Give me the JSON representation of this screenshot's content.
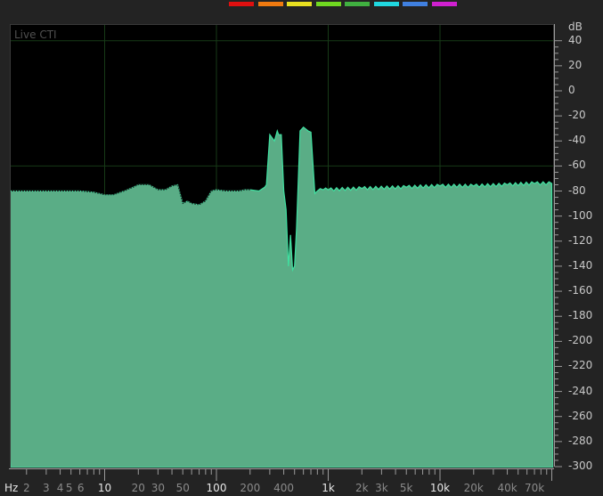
{
  "panel": {
    "label": "Live CTI"
  },
  "colors": {
    "plot_background": "#000000",
    "grid": "#173a17",
    "fill": "#5aad86",
    "outline": "#3fe0a0",
    "trace": "#222222"
  },
  "swatch_colors": [
    "#e01010",
    "#f07a10",
    "#e8e020",
    "#70d820",
    "#40b040",
    "#20d8e0",
    "#4080e0",
    "#d020d0"
  ],
  "db_scale": {
    "unit": "dB",
    "ticks": [
      "40",
      "20",
      "0",
      "-20",
      "-40",
      "-60",
      "-80",
      "-100",
      "-120",
      "-140",
      "-160",
      "-180",
      "-200",
      "-220",
      "-240",
      "-260",
      "-280",
      "-300"
    ]
  },
  "freq_scale": {
    "unit": "Hz",
    "labels": [
      {
        "text": "2",
        "major": false
      },
      {
        "text": "3",
        "major": false
      },
      {
        "text": "4",
        "major": false
      },
      {
        "text": "5",
        "major": false
      },
      {
        "text": "6",
        "major": false
      },
      {
        "text": "10",
        "major": true
      },
      {
        "text": "20",
        "major": false
      },
      {
        "text": "30",
        "major": false
      },
      {
        "text": "50",
        "major": false
      },
      {
        "text": "100",
        "major": true
      },
      {
        "text": "200",
        "major": false
      },
      {
        "text": "400",
        "major": false
      },
      {
        "text": "1k",
        "major": true
      },
      {
        "text": "2k",
        "major": false
      },
      {
        "text": "3k",
        "major": false
      },
      {
        "text": "5k",
        "major": false
      },
      {
        "text": "10k",
        "major": true
      },
      {
        "text": "20k",
        "major": false
      },
      {
        "text": "40k",
        "major": false
      },
      {
        "text": "70k",
        "major": false
      }
    ]
  },
  "chart_data": {
    "type": "area",
    "xlabel": "Hz",
    "ylabel": "dB",
    "x_scale": "log",
    "ylim": [
      -300,
      45
    ],
    "grid": true,
    "series": [
      {
        "x": [
          1,
          2,
          4,
          6,
          8,
          10,
          12,
          15,
          18,
          20,
          25,
          30,
          35,
          40,
          45,
          50,
          55,
          60,
          70,
          80,
          90,
          100,
          120,
          140,
          160,
          180,
          200,
          240,
          270,
          280,
          300,
          330,
          350,
          360,
          380,
          400,
          420,
          440,
          460,
          480,
          500,
          520,
          560,
          600,
          660,
          700,
          760,
          800,
          900,
          1000,
          2000,
          5000,
          10000,
          20000,
          40000,
          70000,
          100000
        ],
        "y": [
          -80,
          -80,
          -80,
          -80,
          -81,
          -83,
          -83,
          -80,
          -77,
          -75,
          -75,
          -79,
          -79,
          -76,
          -75,
          -90,
          -88,
          -90,
          -91,
          -88,
          -80,
          -79,
          -80,
          -80,
          -80,
          -79,
          -79,
          -80,
          -77,
          -75,
          -35,
          -40,
          -32,
          -35,
          -35,
          -80,
          -95,
          -140,
          -115,
          -143,
          -140,
          -110,
          -32,
          -29,
          -32,
          -33,
          -82,
          -80,
          -79,
          -79,
          -78,
          -77,
          -76,
          -76,
          -75,
          -74,
          -74
        ]
      }
    ]
  }
}
